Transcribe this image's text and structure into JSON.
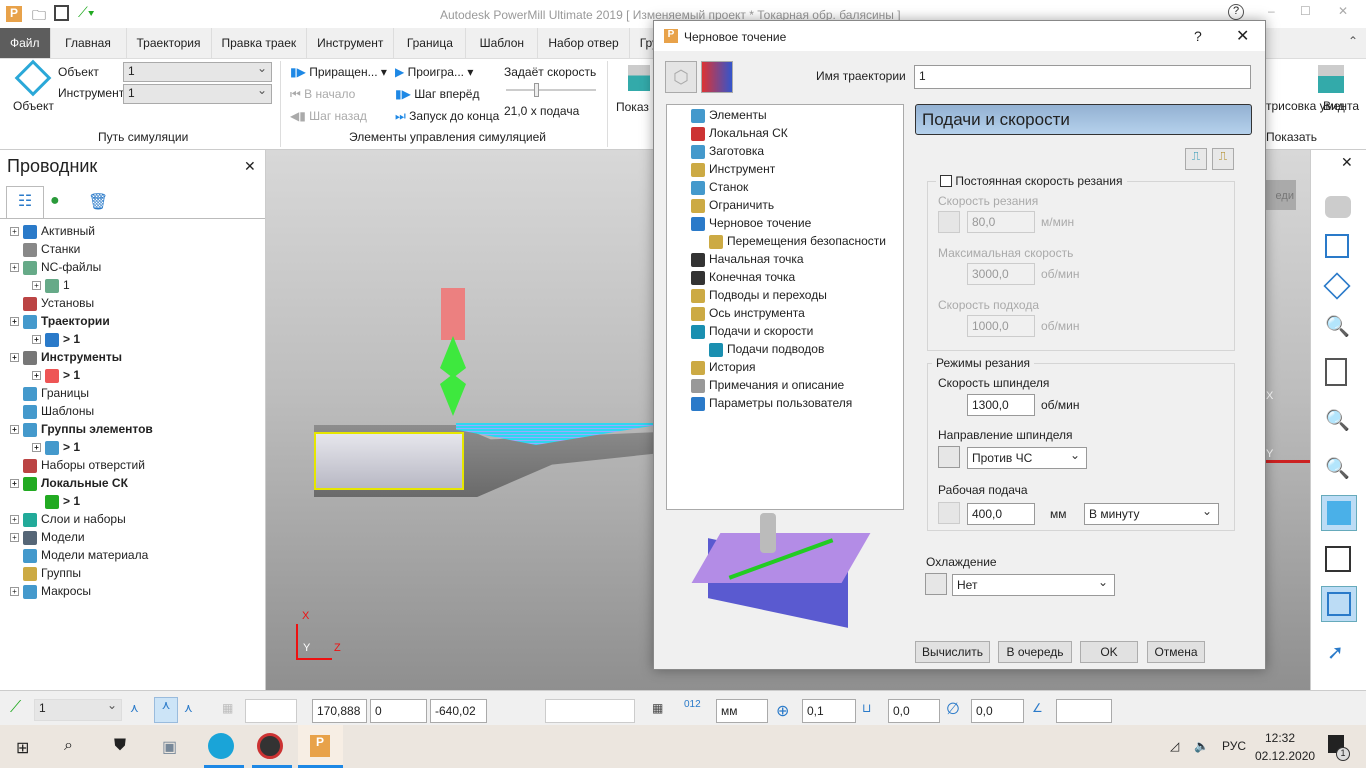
{
  "app": {
    "title": "Autodesk PowerMill Ultimate 2019   [ Изменяемый проект * Токарная обр. балясины ]"
  },
  "ribbon_tabs": [
    "Файл",
    "Главная",
    "Траектория",
    "Правка траек",
    "Инструмент",
    "Граница",
    "Шаблон",
    "Набор отвер",
    "Группа эле"
  ],
  "ribbon": {
    "object_button": "Объект",
    "object_label": "Объект",
    "object_value": "1",
    "tool_label": "Инструмент",
    "tool_value": "1",
    "group1": "Путь симуляции",
    "increment": "Приращен...",
    "to_start": "В начало",
    "step_back": "Шаг назад",
    "play": "Проигра...",
    "step_forward": "Шаг вперёд",
    "run_to_end": "Запуск до конца",
    "speed_label": "Задаёт скорость",
    "speed_value": "21,0 x подача",
    "group2": "Элементы управления симуляцией",
    "show_problems": "Показ проблем",
    "tool_draw": "трисовка умента",
    "view": "Вид",
    "group_show": "Показать"
  },
  "explorer": {
    "title": "Проводник",
    "items": [
      "Активный",
      "Станки",
      "NC-файлы",
      "1",
      "Установы",
      "Траектории",
      "> 1",
      "Инструменты",
      "> 1",
      "Границы",
      "Шаблоны",
      "Группы элементов",
      "> 1",
      "Наборы отверстий",
      "Локальные СК",
      "> 1",
      "Слои и наборы",
      "Модели",
      "Модели материала",
      "Группы",
      "Макросы"
    ]
  },
  "viewport": {
    "axis_x": "X",
    "axis_y": "Y",
    "axis_z": "Z",
    "btn_edit": "еди"
  },
  "dialog": {
    "title": "Черновое точение",
    "help": "?",
    "name_label": "Имя траектории",
    "name_value": "1",
    "tree": [
      "Элементы",
      "Локальная СК",
      "Заготовка",
      "Инструмент",
      "Станок",
      "Ограничить",
      "Черновое точение",
      "Перемещения безопасности",
      "Начальная точка",
      "Конечная точка",
      "Подводы и переходы",
      "Ось инструмента",
      "Подачи и скорости",
      "Подачи подводов",
      "История",
      "Примечания и описание",
      "Параметры пользователя"
    ],
    "section_title": "Подачи и скорости",
    "const_speed": "Постоянная скорость резания",
    "cut_speed_label": "Скорость резания",
    "cut_speed": "80,0",
    "unit_mmin": "м/мин",
    "max_speed_label": "Максимальная скорость",
    "max_speed": "3000,0",
    "unit_rpm": "об/мин",
    "approach_speed_label": "Скорость подхода",
    "approach_speed": "1000,0",
    "modes_title": "Режимы резания",
    "spindle_speed_label": "Скорость шпинделя",
    "spindle_speed": "1300,0",
    "spindle_dir_label": "Направление шпинделя",
    "spindle_dir": "Против ЧС",
    "feed_label": "Рабочая подача",
    "feed": "400,0",
    "unit_mm": "мм",
    "feed_mode": "В минуту",
    "coolant_label": "Охлаждение",
    "coolant": "Нет",
    "buttons": {
      "calc": "Вычислить",
      "queue": "В очередь",
      "ok": "OK",
      "cancel": "Отмена"
    }
  },
  "statusbar": {
    "ucs": "1",
    "x": "170,888",
    "y": "0",
    "z": "-640,02",
    "units": "мм",
    "tol": "0,1",
    "thick": "0,0",
    "diam": "0,0"
  },
  "taskbar": {
    "lang": "РУС",
    "time": "12:32",
    "date": "02.12.2020",
    "notif": "1"
  },
  "colors": {
    "file_tab": "#5d5d5d",
    "section_header": "#a9c4e0",
    "accent": "#1e88e5"
  }
}
